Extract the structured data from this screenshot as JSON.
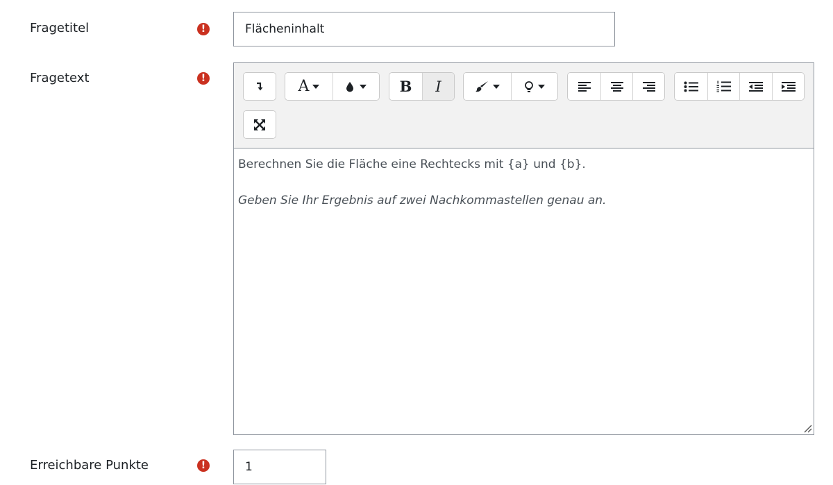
{
  "fields": {
    "title": {
      "label": "Fragetitel",
      "value": "Flächeninhalt"
    },
    "text": {
      "label": "Fragetext",
      "content": [
        {
          "text": "Berechnen Sie die Fläche eine Rechtecks mit {a} und {b}.",
          "italic": false
        },
        {
          "text": "Geben Sie Ihr Ergebnis auf zwei Nachkommastellen genau an.",
          "italic": true
        }
      ]
    },
    "points": {
      "label": "Erreichbare Punkte",
      "value": "1"
    }
  },
  "required_mark": "!",
  "toolbar": {
    "bold_label": "B",
    "italic_label": "I",
    "font_label": "A"
  },
  "colors": {
    "required": "#ca3120",
    "border": "#8f959e",
    "toolbar_bg": "#f2f2f2"
  }
}
